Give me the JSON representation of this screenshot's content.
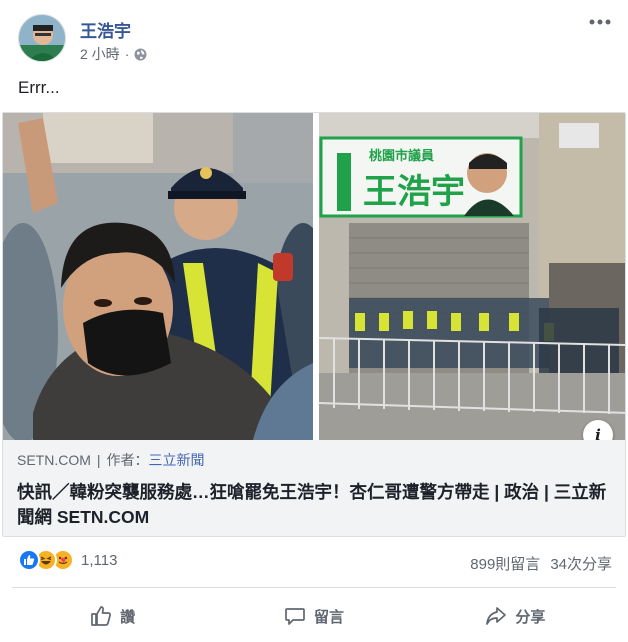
{
  "post": {
    "author": "王浩宇",
    "time": "2 小時",
    "dot": "·",
    "text": "Errr...",
    "more_icon": "ellipsis-icon",
    "privacy_icon": "globe-icon"
  },
  "link_preview": {
    "source": "SETN.COM",
    "separator": "|",
    "author_prefix": "作者：",
    "author_name": "三立新聞",
    "headline": "快訊／韓粉突襲服務處…狂嗆罷免王浩宇！杏仁哥遭警方帶走 | 政治 | 三立新聞網 SETN.COM",
    "info_glyph": "i",
    "sign_small": "桃園市議員",
    "sign_name": "王浩宇"
  },
  "reactions": {
    "icons": [
      "like-reaction-icon",
      "haha-reaction-icon",
      "care-reaction-icon"
    ],
    "count": "1,113",
    "comments": "899則留言",
    "shares": "34次分享"
  },
  "actions": {
    "like": "讚",
    "comment": "留言",
    "share": "分享"
  },
  "colors": {
    "author": "#365899",
    "link": "#4267b2",
    "muted": "#616770",
    "caption_bg": "#f2f3f5",
    "sign_green": "#1fa24a"
  }
}
